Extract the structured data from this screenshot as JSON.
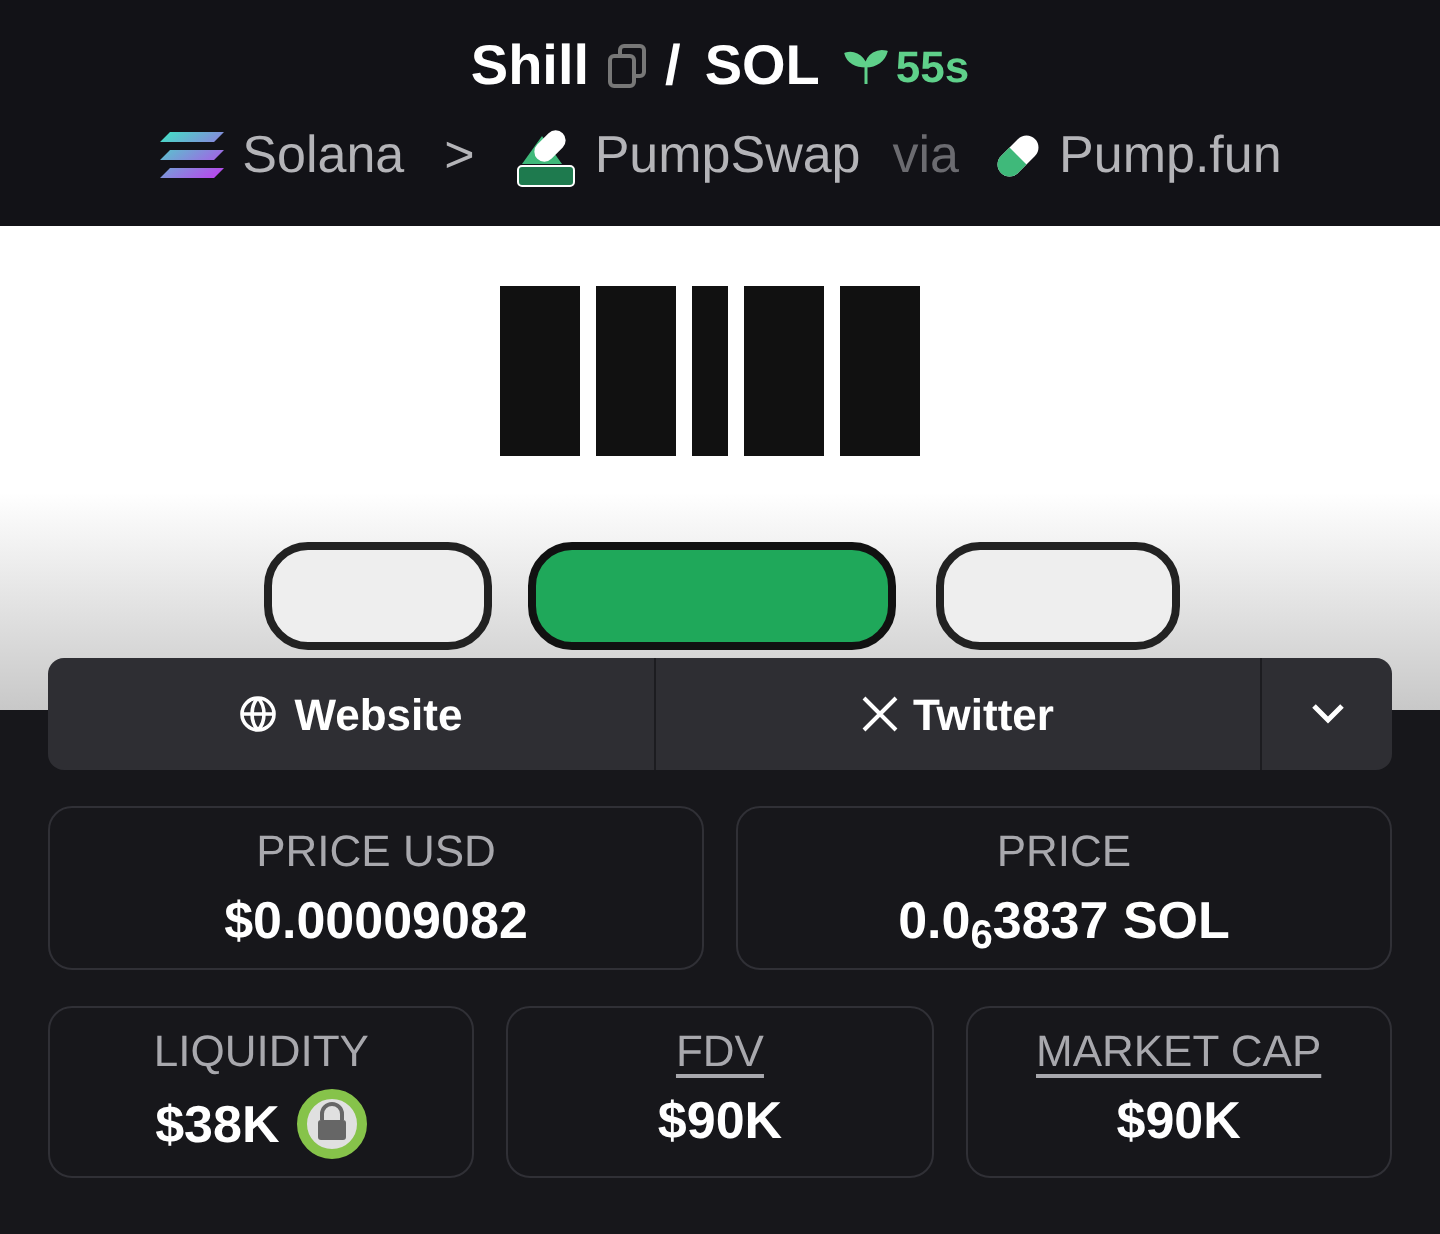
{
  "header": {
    "token": "Shill",
    "separator": "/",
    "quote": "SOL",
    "age": "55s",
    "chain": "Solana",
    "breadcrumb_separator": ">",
    "dex": "PumpSwap",
    "via": "via",
    "launchpad": "Pump.fun"
  },
  "links": [
    {
      "kind": "website",
      "label": "Website"
    },
    {
      "kind": "twitter",
      "label": "Twitter"
    },
    {
      "kind": "more"
    }
  ],
  "price_stats": [
    {
      "label": "PRICE USD",
      "value": "$0.00009082",
      "underlined": false
    },
    {
      "label": "PRICE",
      "value": "0.0$_{6}$3837 SOL",
      "underlined": false
    }
  ],
  "stats": [
    {
      "label": "LIQUIDITY",
      "value": "$38K",
      "underlined": false,
      "locked": true
    },
    {
      "label": "FDV",
      "value": "$90K",
      "underlined": true,
      "locked": false
    },
    {
      "label": "MARKET CAP",
      "value": "$90K",
      "underlined": true,
      "locked": false
    }
  ]
}
